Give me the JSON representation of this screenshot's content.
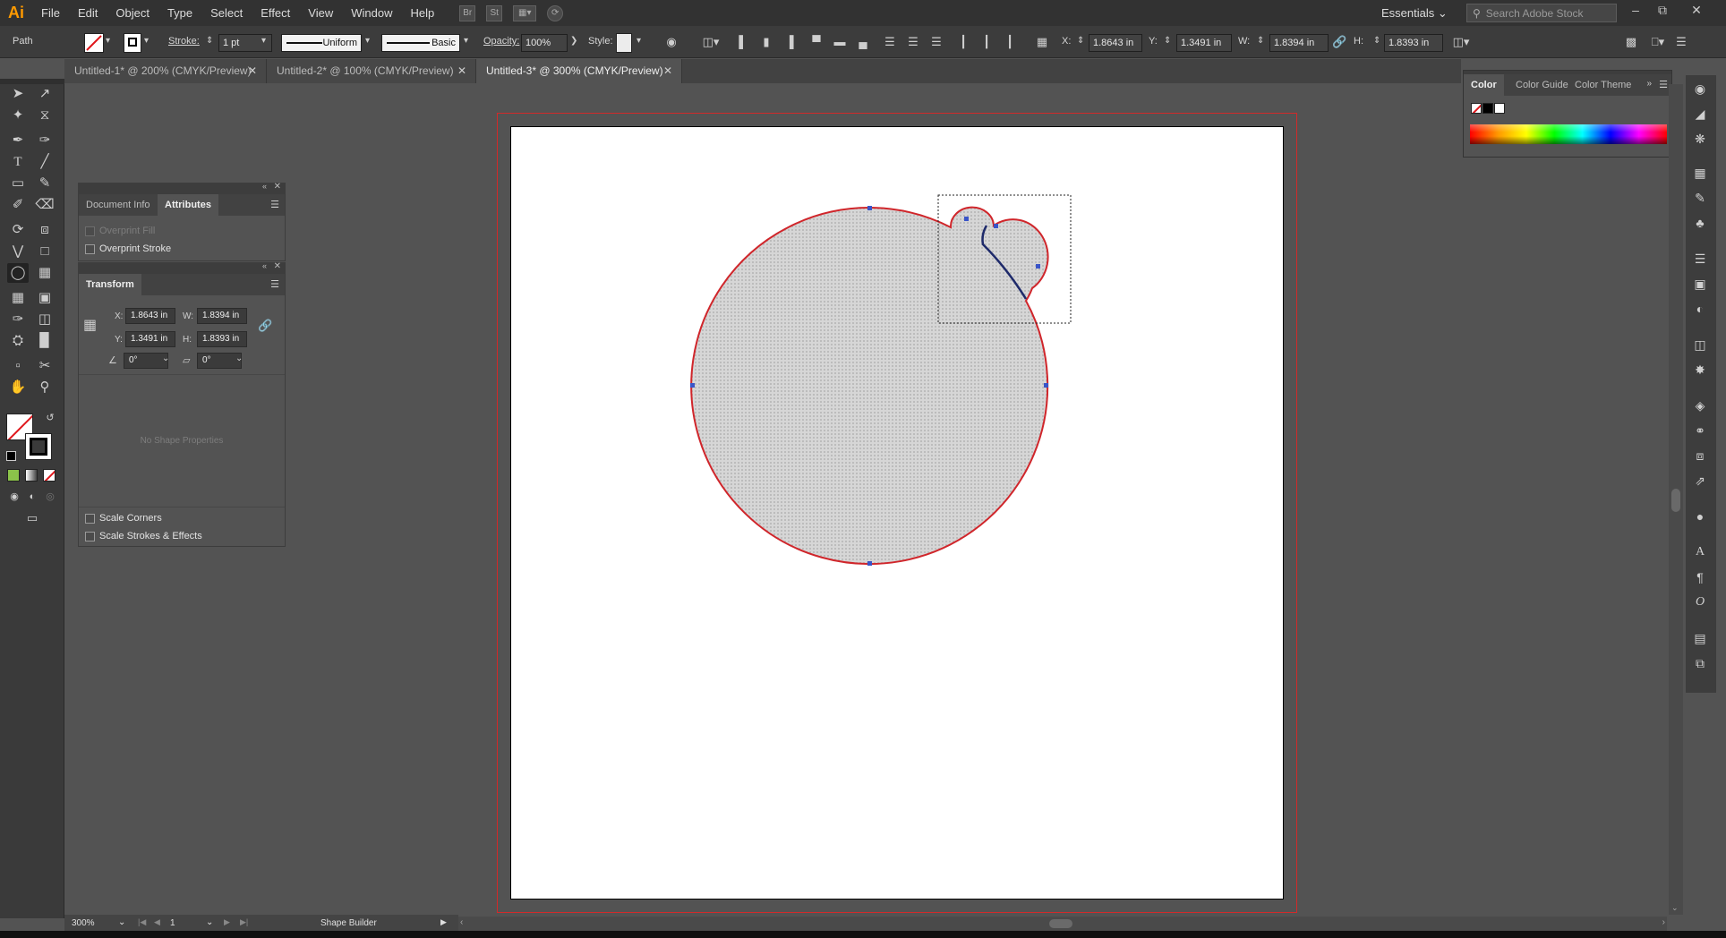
{
  "app": {
    "logo": "Ai"
  },
  "menu": {
    "items": [
      "File",
      "Edit",
      "Object",
      "Type",
      "Select",
      "Effect",
      "View",
      "Window",
      "Help"
    ]
  },
  "menu_icons": {
    "bridge": "Br",
    "stock": "St"
  },
  "workspace": {
    "label": "Essentials"
  },
  "search": {
    "placeholder": "Search Adobe Stock"
  },
  "window_controls": {
    "minimize": "–",
    "restore": "⧉",
    "close": "✕"
  },
  "control_bar": {
    "selection_type": "Path",
    "stroke_label": "Stroke:",
    "stroke_weight": "1 pt",
    "stroke_profile": "Uniform",
    "brush": "Basic",
    "opacity_label": "Opacity:",
    "opacity_value": "100%",
    "style_label": "Style:",
    "x_label": "X:",
    "x_value": "1.8643 in",
    "y_label": "Y:",
    "y_value": "1.3491 in",
    "w_label": "W:",
    "w_value": "1.8394 in",
    "h_label": "H:",
    "h_value": "1.8393 in"
  },
  "tabs": [
    {
      "label": "Untitled-1* @ 200% (CMYK/Preview)"
    },
    {
      "label": "Untitled-2* @ 100% (CMYK/Preview)"
    },
    {
      "label": "Untitled-3* @ 300% (CMYK/Preview)"
    }
  ],
  "attributes_panel": {
    "tab_document_info": "Document Info",
    "tab_attributes": "Attributes",
    "overprint_fill": "Overprint Fill",
    "overprint_stroke": "Overprint Stroke"
  },
  "transform_panel": {
    "title": "Transform",
    "x_label": "X:",
    "x_value": "1.8643 in",
    "y_label": "Y:",
    "y_value": "1.3491 in",
    "w_label": "W:",
    "w_value": "1.8394 in",
    "h_label": "H:",
    "h_value": "1.8393 in",
    "angle_value": "0°",
    "shear_value": "0°",
    "no_shape": "No Shape Properties",
    "scale_corners": "Scale Corners",
    "scale_strokes": "Scale Strokes & Effects"
  },
  "color_panel": {
    "tab_color": "Color",
    "tab_color_guide": "Color Guide",
    "tab_color_themes": "Color Theme"
  },
  "status": {
    "zoom": "300%",
    "artboard": "1",
    "tool": "Shape Builder"
  },
  "colors": {
    "selection_red": "#d0262b",
    "path_blue": "#3a55c8",
    "shape_fill": "#cfcfcf",
    "bleed": "#d22a2a",
    "accent": "#ff9a00"
  }
}
